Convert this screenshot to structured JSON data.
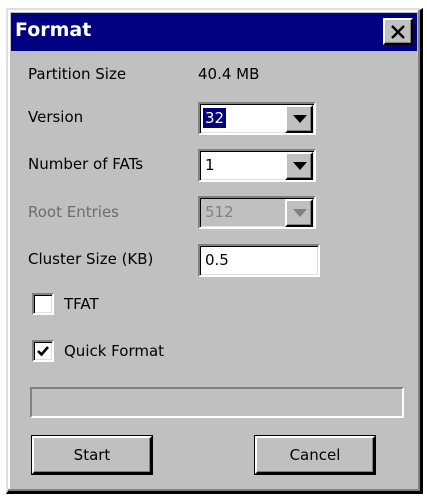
{
  "window": {
    "title": "Format"
  },
  "fields": {
    "partition_size_label": "Partition Size",
    "partition_size_value": "40.4 MB",
    "version_label": "Version",
    "version_value": "32",
    "num_fats_label": "Number of FATs",
    "num_fats_value": "1",
    "root_entries_label": "Root Entries",
    "root_entries_value": "512",
    "cluster_size_label": "Cluster Size (KB)",
    "cluster_size_value": "0.5"
  },
  "options": {
    "tfat_label": "TFAT",
    "tfat_checked": false,
    "quick_format_label": "Quick Format",
    "quick_format_checked": true
  },
  "progress": {
    "value": 0
  },
  "buttons": {
    "start_label": "Start",
    "cancel_label": "Cancel"
  },
  "colors": {
    "titlebar": "#000080",
    "face": "#c0c0c0",
    "selection": "#000080"
  },
  "icons": {
    "close": "close-icon",
    "dropdown": "chevron-down-icon",
    "check": "checkmark-icon"
  }
}
